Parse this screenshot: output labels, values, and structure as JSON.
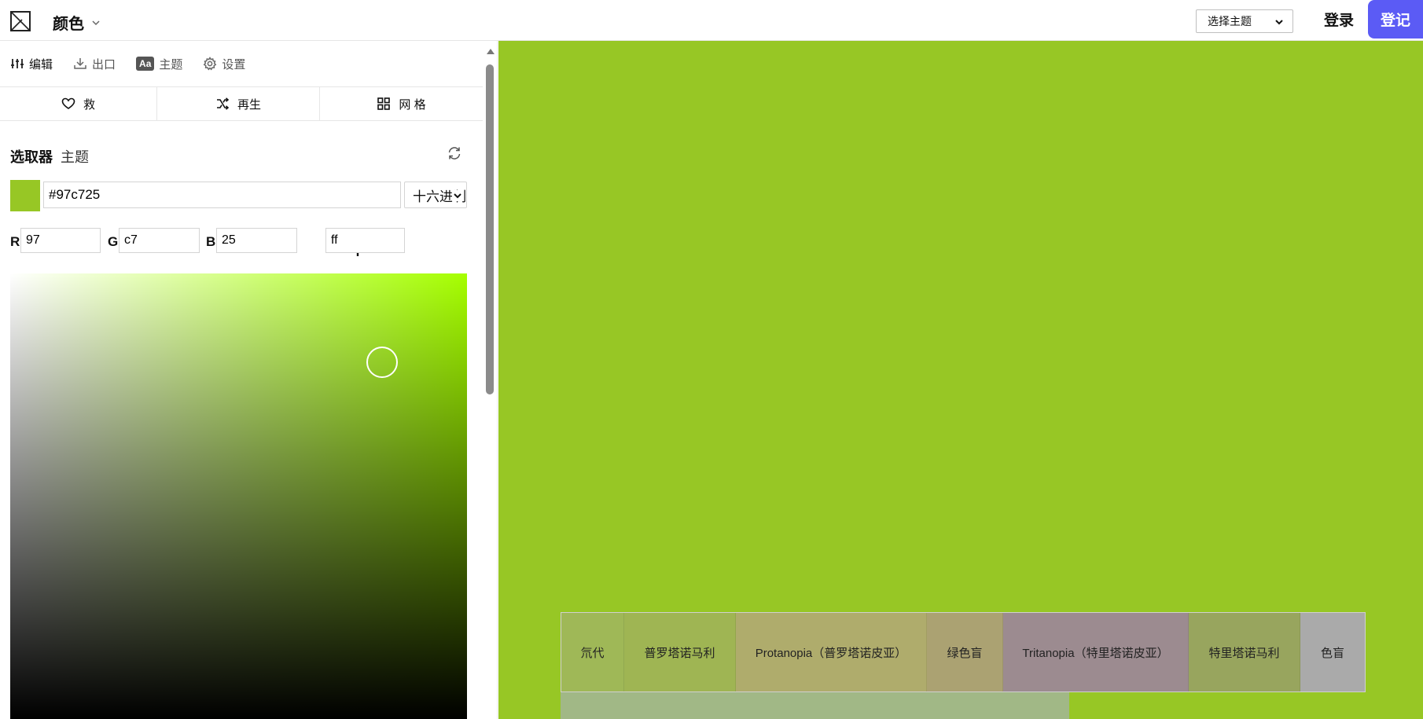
{
  "topbar": {
    "app_title": "颜色",
    "theme_select": "选择主题",
    "login": "登录",
    "signup": "登记"
  },
  "panel": {
    "tabs": [
      {
        "label": "编辑",
        "icon": "sliders-icon",
        "active": true
      },
      {
        "label": "出口",
        "icon": "download-icon",
        "active": false
      },
      {
        "label": "主题",
        "icon": "aa-icon",
        "badge": "Aa",
        "active": false
      },
      {
        "label": "设置",
        "icon": "gear-icon",
        "active": false
      }
    ],
    "actions": [
      {
        "label": "救",
        "icon": "heart-icon"
      },
      {
        "label": "再生",
        "icon": "shuffle-icon"
      },
      {
        "label": "网 格",
        "icon": "grid-icon"
      }
    ],
    "picker": {
      "title": "选取器",
      "subtitle": "主题",
      "hex": "#97c725",
      "format": "十六进制",
      "r_label": "R",
      "r": "97",
      "g_label": "G",
      "g": "c7",
      "b_label": "B",
      "b": "25",
      "alpha": "ff",
      "hue_color": "#a6ff00"
    }
  },
  "preview": {
    "color": "#97c725",
    "simulations": [
      {
        "label": "氘代",
        "color": "#9fb857"
      },
      {
        "label": "普罗塔诺马利",
        "color": "#9fb553"
      },
      {
        "label": "Protanopia（普罗塔诺皮亚）",
        "color": "#afac6c"
      },
      {
        "label": "绿色盲",
        "color": "#aba272"
      },
      {
        "label": "Tritanopia（特里塔诺皮亚）",
        "color": "#9c8b90"
      },
      {
        "label": "特里塔诺马利",
        "color": "#98a55e"
      },
      {
        "label": "色盲",
        "color": "#aaaaaa"
      }
    ],
    "extra_color": "#a1b886"
  }
}
